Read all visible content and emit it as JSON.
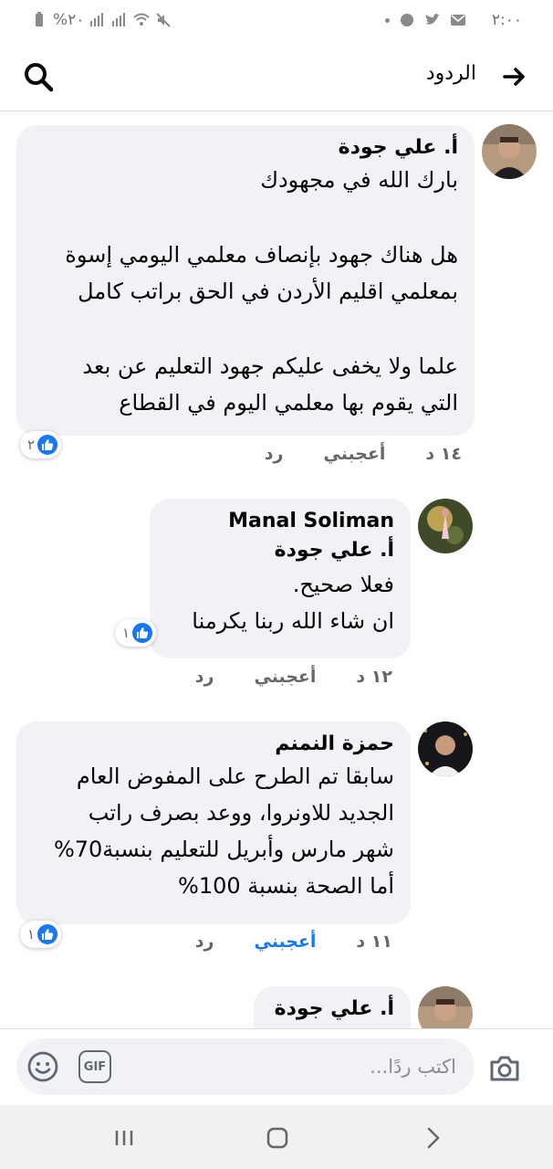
{
  "status_bar": {
    "time": "٢:٠٠",
    "battery": "%٢٠"
  },
  "header": {
    "title": "الردود"
  },
  "comments": [
    {
      "author": "أ. علي جودة",
      "lines": [
        "بارك الله في مجهودك",
        "",
        "هل هناك جهود بإنصاف معلمي اليومي إسوة",
        "بمعلمي اقليم الأردن في الحق براتب كامل",
        "",
        "علما ولا يخفى عليكم جهود التعليم عن بعد",
        "التي يقوم بها معلمي اليوم في القطاع"
      ],
      "reaction_count": "٢",
      "time": "١٤ د",
      "like_label": "أعجبني",
      "reply_label": "رد"
    },
    {
      "author": "Manal Soliman",
      "mention": "أ. علي جودة",
      "lines": [
        "فعلا صحيح.",
        "ان شاء الله ربنا يكرمنا"
      ],
      "reaction_count": "١",
      "time": "١٢ د",
      "like_label": "أعجبني",
      "reply_label": "رد"
    },
    {
      "author": "حمزة النمنم",
      "lines": [
        "سابقا تم الطرح على المفوض العام",
        "الجديد للاونروا، ووعد بصرف راتب",
        "شهر مارس وأبريل للتعليم بنسبة70%",
        "أما الصحة بنسبة 100%"
      ],
      "reaction_count": "١",
      "time": "١١ د",
      "like_label": "أعجبني",
      "reply_label": "رد",
      "liked": true,
      "like_color": "#1877f2"
    },
    {
      "author": "أ. علي جودة"
    }
  ],
  "composer": {
    "placeholder": "اكتب ردًا...",
    "gif_label": "GIF"
  },
  "icons": {
    "back": "arrow-right-icon",
    "search": "search-icon",
    "camera": "camera-icon",
    "gif": "gif-icon",
    "emoji": "emoji-icon",
    "like": "like-icon",
    "recent_apps": "recent-apps-icon",
    "home": "home-icon",
    "nav_back": "nav-back-icon"
  },
  "colors": {
    "accent": "#1877f2",
    "bubble": "#f0f2f5",
    "meta": "#65676b"
  }
}
